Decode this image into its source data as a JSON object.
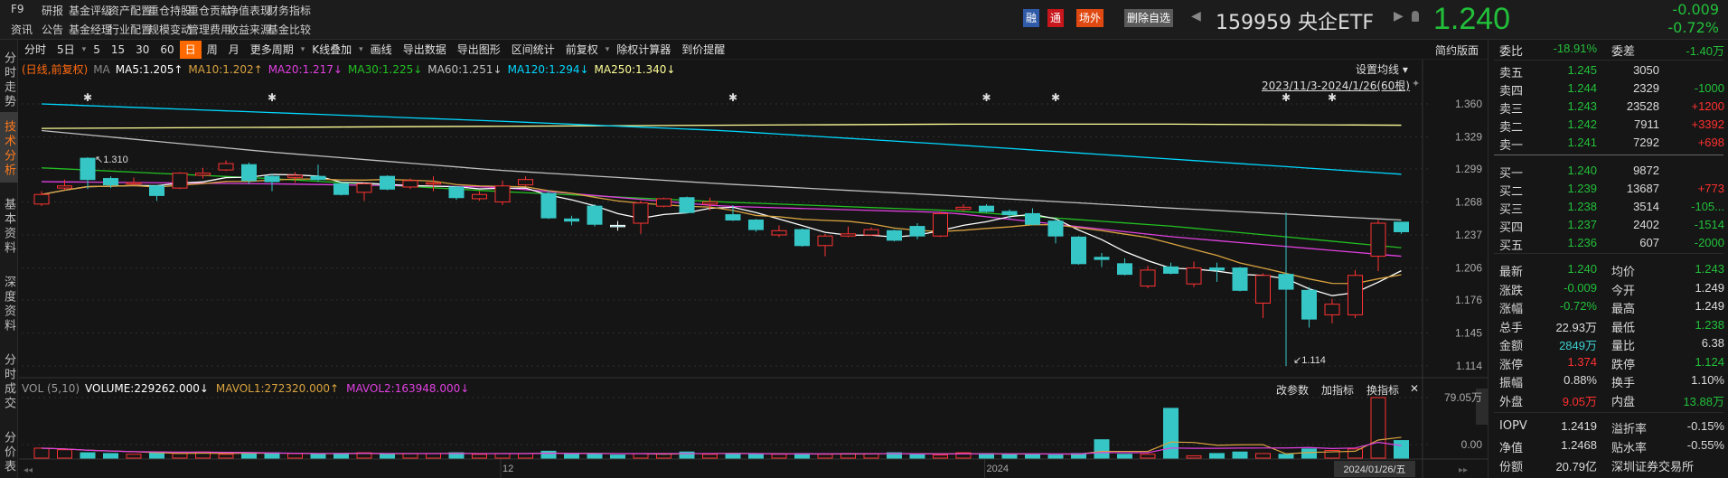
{
  "header": {
    "nav_row1": [
      "F9",
      "研报",
      "基金评级",
      "资产配置",
      "重仓持股",
      "重仓贡献",
      "净值表现",
      "财务指标"
    ],
    "nav_row2": [
      "资讯",
      "公告",
      "基金经理",
      "行业配置",
      "规模变动",
      "管理费用",
      "收益来源",
      "基金比较"
    ],
    "badges": [
      {
        "label": "融",
        "color": "#2f5aa8"
      },
      {
        "label": "通",
        "color": "#c8161d"
      },
      {
        "label": "场外",
        "color": "#e04a12"
      },
      {
        "label": "删除自选",
        "color": "#5a5a5a"
      }
    ],
    "prev_icon": "◀",
    "next_icon": "▶",
    "bell_icon": "bell-icon",
    "security": "159959 央企ETF",
    "price": "1.240",
    "change": "-0.009",
    "change_pct": "-0.72%"
  },
  "side_tabs": [
    "分时走势",
    "技术分析",
    "基本资料",
    "深度资料",
    "分时成交",
    "分价表"
  ],
  "toolbar": {
    "items": [
      "分时",
      "5日",
      "▾",
      "5",
      "15",
      "30",
      "60",
      "日",
      "周",
      "月",
      "更多周期",
      "▾",
      "K线叠加",
      "▾",
      "画线",
      "导出数据",
      "导出图形",
      "区间统计",
      "前复权",
      "▾",
      "除权计算器",
      "到价提醒"
    ],
    "active": "日",
    "layout_button": "简约版面"
  },
  "ma_legend": {
    "mode": "(日线,前复权)",
    "prefix": "MA",
    "items": [
      {
        "label": "MA5:1.205↑",
        "color": "#ffffff"
      },
      {
        "label": "MA10:1.202↑",
        "color": "#d9a33f"
      },
      {
        "label": "MA20:1.217↓",
        "color": "#e040e0"
      },
      {
        "label": "MA30:1.225↓",
        "color": "#22c022"
      },
      {
        "label": "MA60:1.251↓",
        "color": "#c0c0c0"
      },
      {
        "label": "MA120:1.294↓",
        "color": "#00d8ff"
      },
      {
        "label": "MA250:1.340↓",
        "color": "#ffff99"
      }
    ]
  },
  "chart_controls": {
    "set_ma": "设置均线 ▾",
    "range": "2023/11/3-2024/1/26(60根)",
    "pin_icon": "📌"
  },
  "chart_data": {
    "type": "candlestick",
    "y_ticks": [
      1.36,
      1.329,
      1.299,
      1.268,
      1.237,
      1.206,
      1.176,
      1.145,
      1.114
    ],
    "ylim": [
      1.114,
      1.36
    ],
    "ohlc": [
      [
        1.266,
        1.275,
        1.278,
        1.264
      ],
      [
        1.281,
        1.283,
        1.289,
        1.279
      ],
      [
        1.309,
        1.289,
        1.31,
        1.28
      ],
      [
        1.29,
        1.284,
        1.292,
        1.281
      ],
      [
        1.285,
        1.286,
        1.291,
        1.284
      ],
      [
        1.283,
        1.274,
        1.284,
        1.269
      ],
      [
        1.281,
        1.295,
        1.296,
        1.28
      ],
      [
        1.293,
        1.295,
        1.3,
        1.29
      ],
      [
        1.298,
        1.304,
        1.307,
        1.297
      ],
      [
        1.303,
        1.288,
        1.305,
        1.285
      ],
      [
        1.292,
        1.287,
        1.294,
        1.278
      ],
      [
        1.291,
        1.293,
        1.296,
        1.286
      ],
      [
        1.292,
        1.289,
        1.303,
        1.287
      ],
      [
        1.285,
        1.275,
        1.286,
        1.274
      ],
      [
        1.277,
        1.285,
        1.286,
        1.269
      ],
      [
        1.292,
        1.28,
        1.293,
        1.279
      ],
      [
        1.282,
        1.288,
        1.29,
        1.28
      ],
      [
        1.285,
        1.286,
        1.292,
        1.278
      ],
      [
        1.282,
        1.272,
        1.283,
        1.27
      ],
      [
        1.271,
        1.275,
        1.278,
        1.269
      ],
      [
        1.268,
        1.283,
        1.288,
        1.265
      ],
      [
        1.284,
        1.289,
        1.292,
        1.283
      ],
      [
        1.276,
        1.253,
        1.279,
        1.252
      ],
      [
        1.252,
        1.25,
        1.255,
        1.246
      ],
      [
        1.264,
        1.247,
        1.266,
        1.245
      ],
      [
        1.246,
        1.246,
        1.25,
        1.241
      ],
      [
        1.248,
        1.267,
        1.269,
        1.238
      ],
      [
        1.264,
        1.271,
        1.272,
        1.263
      ],
      [
        1.272,
        1.258,
        1.273,
        1.257
      ],
      [
        1.266,
        1.268,
        1.272,
        1.26
      ],
      [
        1.256,
        1.251,
        1.265,
        1.25
      ],
      [
        1.251,
        1.242,
        1.252,
        1.24
      ],
      [
        1.237,
        1.241,
        1.246,
        1.235
      ],
      [
        1.242,
        1.227,
        1.243,
        1.226
      ],
      [
        1.227,
        1.236,
        1.238,
        1.217
      ],
      [
        1.236,
        1.238,
        1.245,
        1.235
      ],
      [
        1.237,
        1.242,
        1.244,
        1.236
      ],
      [
        1.241,
        1.232,
        1.242,
        1.231
      ],
      [
        1.245,
        1.236,
        1.248,
        1.233
      ],
      [
        1.236,
        1.257,
        1.259,
        1.235
      ],
      [
        1.261,
        1.263,
        1.266,
        1.259
      ],
      [
        1.264,
        1.259,
        1.266,
        1.258
      ],
      [
        1.259,
        1.256,
        1.261,
        1.252
      ],
      [
        1.257,
        1.247,
        1.262,
        1.246
      ],
      [
        1.25,
        1.236,
        1.252,
        1.229
      ],
      [
        1.235,
        1.21,
        1.236,
        1.209
      ],
      [
        1.216,
        1.214,
        1.22,
        1.207
      ],
      [
        1.21,
        1.2,
        1.215,
        1.199
      ],
      [
        1.189,
        1.204,
        1.208,
        1.187
      ],
      [
        1.207,
        1.201,
        1.211,
        1.2
      ],
      [
        1.191,
        1.206,
        1.212,
        1.188
      ],
      [
        1.206,
        1.204,
        1.211,
        1.193
      ],
      [
        1.206,
        1.185,
        1.207,
        1.184
      ],
      [
        1.173,
        1.199,
        1.201,
        1.159
      ],
      [
        1.2,
        1.186,
        1.258,
        1.114
      ],
      [
        1.185,
        1.158,
        1.188,
        1.15
      ],
      [
        1.162,
        1.172,
        1.177,
        1.154
      ],
      [
        1.162,
        1.199,
        1.204,
        1.159
      ],
      [
        1.217,
        1.248,
        1.251,
        1.203
      ],
      [
        1.249,
        1.24,
        1.249,
        1.238
      ]
    ],
    "ma_lines": [
      {
        "name": "MA250",
        "color": "#ffff99",
        "anchors": [
          1.337,
          1.338,
          1.339,
          1.34,
          1.341,
          1.341,
          1.34
        ]
      },
      {
        "name": "MA120",
        "color": "#00d8ff",
        "anchors": [
          1.36,
          1.352,
          1.344,
          1.335,
          1.322,
          1.308,
          1.294
        ]
      },
      {
        "name": "MA60",
        "color": "#c0c0c0",
        "anchors": [
          1.335,
          1.315,
          1.298,
          1.285,
          1.274,
          1.262,
          1.251
        ]
      },
      {
        "name": "MA30",
        "color": "#22c022",
        "anchors": [
          1.3,
          1.29,
          1.278,
          1.268,
          1.26,
          1.245,
          1.225
        ]
      },
      {
        "name": "MA20",
        "color": "#e040e0",
        "anchors": [
          1.287,
          1.285,
          1.282,
          1.264,
          1.258,
          1.235,
          1.217
        ]
      }
    ],
    "computed_ma": [
      {
        "name": "MA5",
        "period": 5,
        "color": "#ffffff"
      },
      {
        "name": "MA10",
        "period": 10,
        "color": "#d9a33f"
      }
    ],
    "star_markers": [
      2,
      10,
      30,
      41,
      44,
      54,
      56
    ],
    "annotations": [
      {
        "index": 2,
        "label": "↖1.310"
      },
      {
        "index": 54,
        "label": "↙1.114"
      }
    ],
    "volume": [
      13,
      11,
      7,
      6,
      5,
      7,
      6,
      8,
      5,
      6,
      7,
      6,
      5,
      6,
      7,
      5,
      6,
      6,
      7,
      5,
      6,
      6,
      9,
      5,
      5,
      4,
      6,
      6,
      8,
      5,
      6,
      5,
      5,
      6,
      5,
      6,
      6,
      7,
      5,
      4,
      7,
      6,
      5,
      5,
      4,
      6,
      24,
      5,
      5,
      65,
      3,
      6,
      8,
      6,
      5,
      12,
      10,
      12,
      79.05,
      22.93
    ],
    "volume_ticks": [
      "79.05万",
      "0.00"
    ],
    "vol_max": 79.05,
    "x_labels": [
      {
        "index": 20,
        "label": "12"
      },
      {
        "index": 41,
        "label": "2024"
      }
    ],
    "cursor_date": "2024/01/26/五"
  },
  "vol_legend": {
    "title": "VOL (5,10)",
    "items": [
      {
        "label": "VOLUME:229262.000↓",
        "color": "#ffffff"
      },
      {
        "label": "MAVOL1:272320.000↑",
        "color": "#d9a33f"
      },
      {
        "label": "MAVOL2:163948.000↓",
        "color": "#e040e0"
      }
    ],
    "buttons": [
      "改参数",
      "加指标",
      "换指标",
      "✕"
    ]
  },
  "right_panel": {
    "weibi_label": "委比",
    "weibi": "-18.91%",
    "weicha_label": "委差",
    "weicha": "-1.40万",
    "asks": [
      {
        "label": "卖五",
        "price": "1.245",
        "vol": "3050",
        "chg": ""
      },
      {
        "label": "卖四",
        "price": "1.244",
        "vol": "2329",
        "chg": "-1000"
      },
      {
        "label": "卖三",
        "price": "1.243",
        "vol": "23528",
        "chg": "+1200"
      },
      {
        "label": "卖二",
        "price": "1.242",
        "vol": "7911",
        "chg": "+3392"
      },
      {
        "label": "卖一",
        "price": "1.241",
        "vol": "7292",
        "chg": "+698"
      }
    ],
    "bids": [
      {
        "label": "买一",
        "price": "1.240",
        "vol": "9872",
        "chg": ""
      },
      {
        "label": "买二",
        "price": "1.239",
        "vol": "13687",
        "chg": "+773"
      },
      {
        "label": "买三",
        "price": "1.238",
        "vol": "3514",
        "chg": "-105..."
      },
      {
        "label": "买四",
        "price": "1.237",
        "vol": "2402",
        "chg": "-1514"
      },
      {
        "label": "买五",
        "price": "1.236",
        "vol": "607",
        "chg": "-2000"
      }
    ],
    "stats": [
      {
        "l1": "最新",
        "v1": "1.240",
        "c1": "g",
        "l2": "均价",
        "v2": "1.243",
        "c2": "g"
      },
      {
        "l1": "涨跌",
        "v1": "-0.009",
        "c1": "g",
        "l2": "今开",
        "v2": "1.249",
        "c2": "w"
      },
      {
        "l1": "涨幅",
        "v1": "-0.72%",
        "c1": "g",
        "l2": "最高",
        "v2": "1.249",
        "c2": "w"
      },
      {
        "l1": "总手",
        "v1": "22.93万",
        "c1": "w",
        "l2": "最低",
        "v2": "1.238",
        "c2": "g"
      },
      {
        "l1": "金额",
        "v1": "2849万",
        "c1": "c",
        "l2": "量比",
        "v2": "6.38",
        "c2": "w"
      },
      {
        "l1": "涨停",
        "v1": "1.374",
        "c1": "r",
        "l2": "跌停",
        "v2": "1.124",
        "c2": "g"
      },
      {
        "l1": "振幅",
        "v1": "0.88%",
        "c1": "w",
        "l2": "换手",
        "v2": "1.10%",
        "c2": "w"
      },
      {
        "l1": "外盘",
        "v1": "9.05万",
        "c1": "r",
        "l2": "内盘",
        "v2": "13.88万",
        "c2": "g"
      }
    ],
    "fund": [
      {
        "l1": "IOPV",
        "v1": "1.2419",
        "l2": "溢折率",
        "v2": "-0.15%"
      },
      {
        "l1": "净值",
        "v1": "1.2468",
        "l2": "贴水率",
        "v2": "-0.55%"
      },
      {
        "l1": "份额",
        "v1": "20.79亿",
        "l2": "深圳证券交易所",
        "v2": ""
      }
    ]
  }
}
